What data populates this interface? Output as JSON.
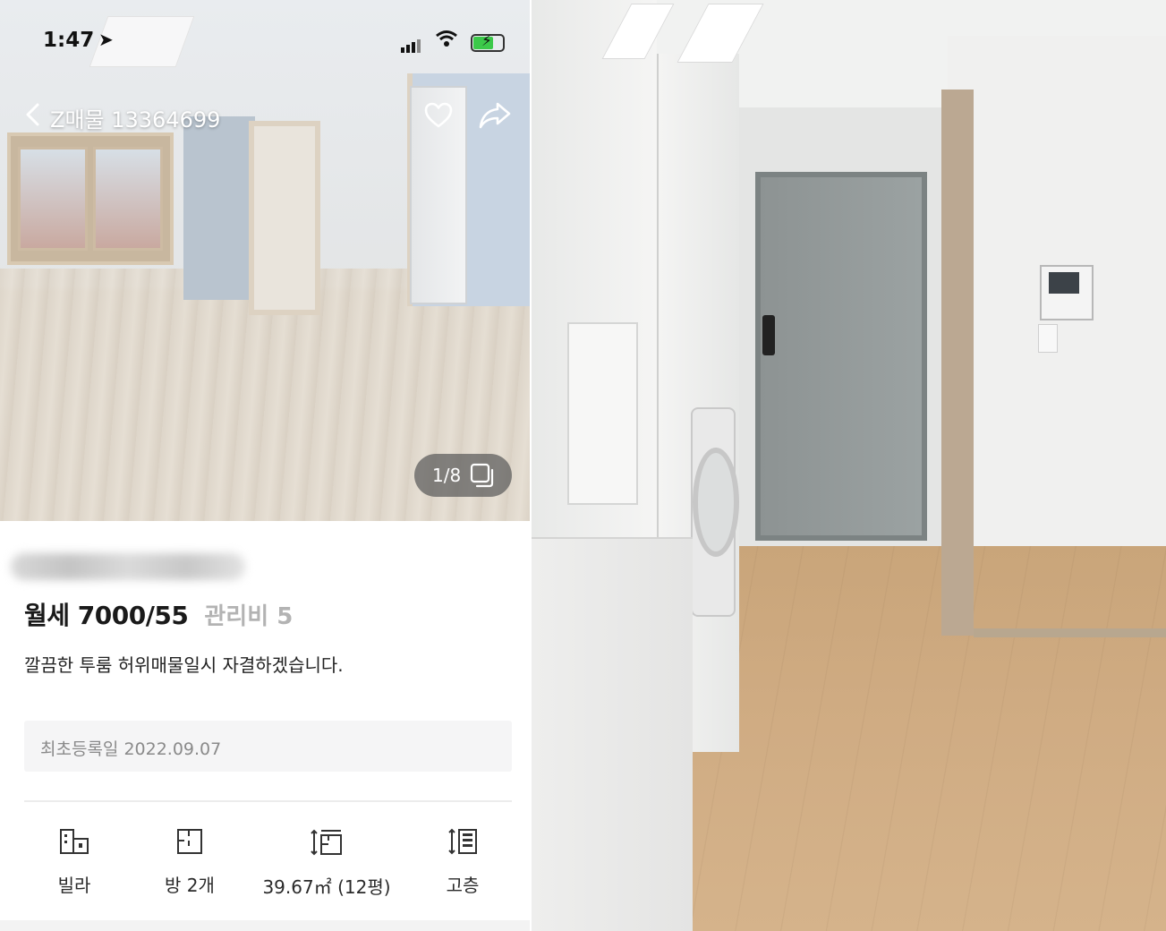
{
  "status_bar": {
    "time": "1:47",
    "battery_color": "#3cc94a"
  },
  "header": {
    "title": "Z매물 13364699",
    "back_icon": "chevron-left-icon",
    "favorite_icon": "heart-icon",
    "share_icon": "share-icon"
  },
  "gallery": {
    "counter": "1/8",
    "icon": "gallery-icon"
  },
  "listing": {
    "price": "월세 7000/55",
    "maintenance_fee": "관리비 5",
    "description": "깔끔한 투룸 허위매물일시 자결하겠습니다.",
    "registered": "최초등록일 2022.09.07"
  },
  "features": [
    {
      "icon": "building-icon",
      "label": "빌라"
    },
    {
      "icon": "room-icon",
      "label": "방 2개"
    },
    {
      "icon": "area-icon",
      "label": "39.67㎡ (12평)"
    },
    {
      "icon": "floor-height-icon",
      "label": "고층"
    }
  ]
}
